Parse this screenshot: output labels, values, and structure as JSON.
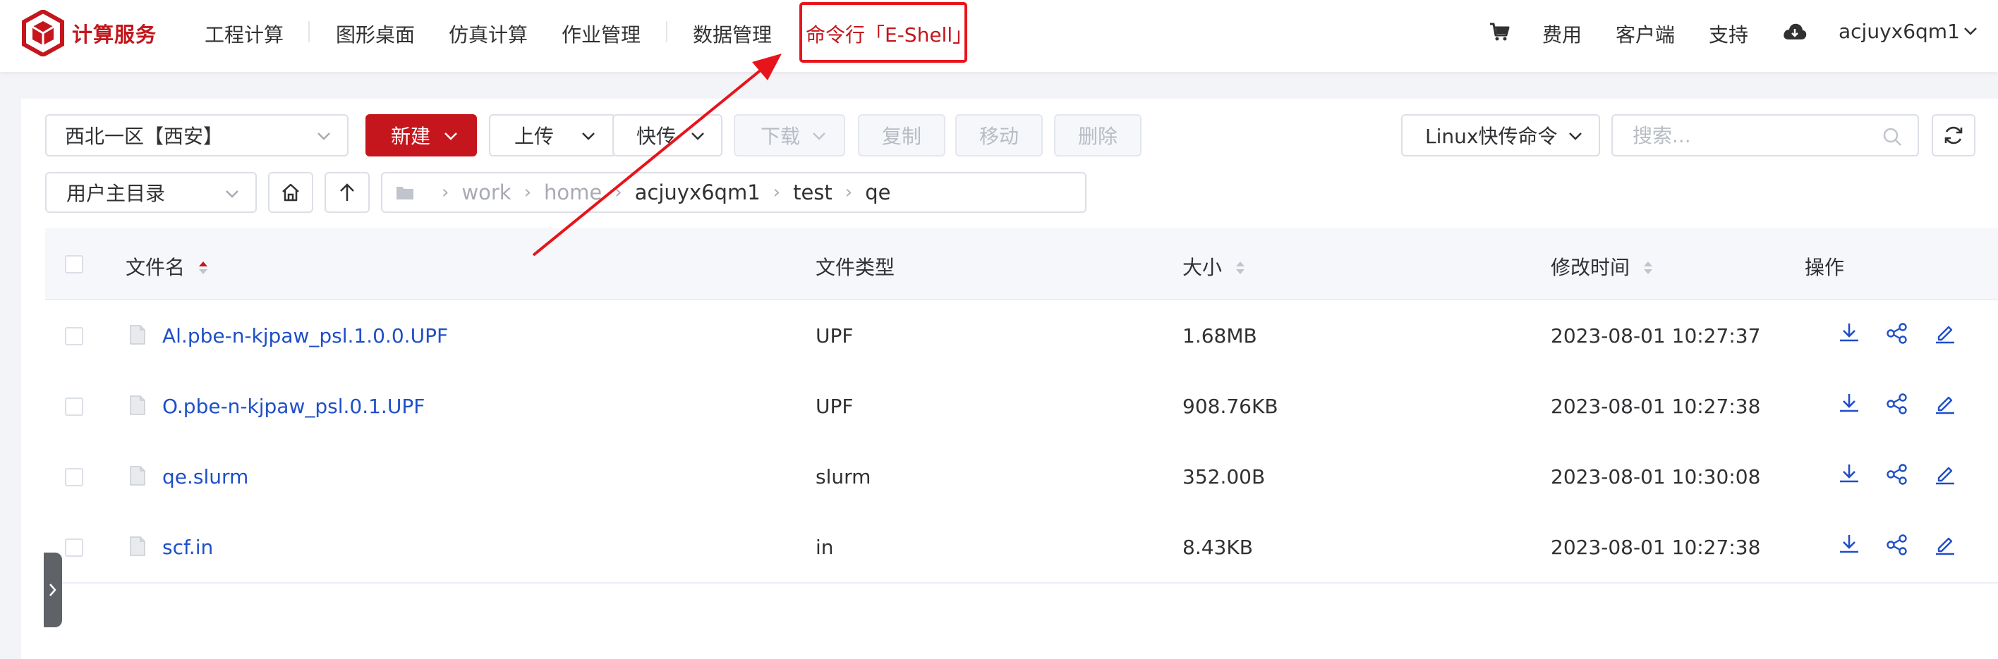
{
  "nav": {
    "brand": "计算服务",
    "items": [
      "工程计算",
      "图形桌面",
      "仿真计算",
      "作业管理",
      "数据管理",
      "命令行「E-Shell」"
    ],
    "right": {
      "cost": "费用",
      "client": "客户端",
      "support": "支持",
      "user": "acjuyx6qm1"
    }
  },
  "toolbar": {
    "region": "西北一区【西安】",
    "new": "新建",
    "upload": "上传",
    "fast_transfer": "快传",
    "download": "下载",
    "copy": "复制",
    "move": "移动",
    "delete": "删除",
    "linux_cmd": "Linux快传命令",
    "search_placeholder": "搜索..."
  },
  "path": {
    "scope": "用户主目录",
    "crumbs": [
      "work",
      "home",
      "acjuyx6qm1",
      "test",
      "qe"
    ]
  },
  "table": {
    "headers": {
      "name": "文件名",
      "type": "文件类型",
      "size": "大小",
      "modified": "修改时间",
      "actions": "操作"
    },
    "rows": [
      {
        "name": "Al.pbe-n-kjpaw_psl.1.0.0.UPF",
        "type": "UPF",
        "size": "1.68MB",
        "modified": "2023-08-01 10:27:37"
      },
      {
        "name": "O.pbe-n-kjpaw_psl.0.1.UPF",
        "type": "UPF",
        "size": "908.76KB",
        "modified": "2023-08-01 10:27:38"
      },
      {
        "name": "qe.slurm",
        "type": "slurm",
        "size": "352.00B",
        "modified": "2023-08-01 10:30:08"
      },
      {
        "name": "scf.in",
        "type": "in",
        "size": "8.43KB",
        "modified": "2023-08-01 10:27:38"
      }
    ]
  },
  "icons": {
    "logo": "cube-logo-icon",
    "cart": "cart-icon",
    "cloud": "cloud-download-icon",
    "home": "home-icon",
    "up": "arrow-up-icon",
    "folder": "folder-icon",
    "refresh": "refresh-icon",
    "search": "search-icon",
    "file": "file-icon",
    "row_actions": [
      "download-icon",
      "share-icon",
      "edit-icon"
    ]
  },
  "colors": {
    "brand": "#c4161c",
    "link": "#1f4fc8",
    "annotation": "#e8141b"
  }
}
